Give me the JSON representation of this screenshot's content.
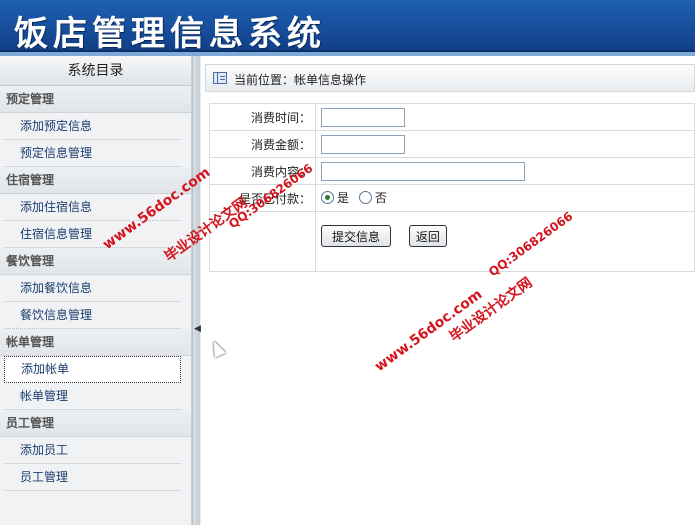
{
  "header": {
    "title": "饭店管理信息系统"
  },
  "sidebar": {
    "title": "系统目录",
    "groups": [
      {
        "title": "预定管理",
        "items": [
          "添加预定信息",
          "预定信息管理"
        ]
      },
      {
        "title": "住宿管理",
        "items": [
          "添加住宿信息",
          "住宿信息管理"
        ]
      },
      {
        "title": "餐饮管理",
        "items": [
          "添加餐饮信息",
          "餐饮信息管理"
        ]
      },
      {
        "title": "帐单管理",
        "items": [
          "添加帐单",
          "帐单管理"
        ]
      },
      {
        "title": "员工管理",
        "items": [
          "添加员工",
          "员工管理"
        ]
      }
    ],
    "active_item": "添加帐单"
  },
  "location": {
    "text": "当前位置：帐单信息操作"
  },
  "form": {
    "time_label": "消费时间：",
    "time_value": "",
    "amount_label": "消费金额：",
    "amount_value": "",
    "content_label": "消费内容：",
    "content_value": "",
    "paid_label": "是否已付款：",
    "paid_options": [
      "是",
      "否"
    ],
    "paid_selected": "是",
    "submit_label": "提交信息",
    "back_label": "返回"
  },
  "watermark": {
    "site": "www.56doc.com",
    "name": "毕业设计论文网",
    "qq": "QQ:306826066"
  },
  "colors": {
    "banner": "#1a56a6",
    "watermark": "#d4141e",
    "link": "#1a3c6e"
  },
  "icons": {
    "location": "panel-icon",
    "collapse": "triangle-left-icon",
    "cursor": "mouse-pointer-icon"
  }
}
